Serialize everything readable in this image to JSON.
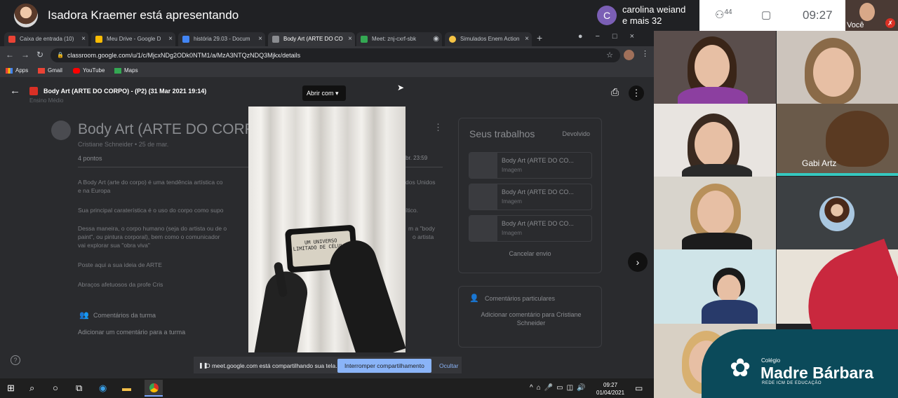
{
  "meet": {
    "presenter_title": "Isadora Kraemer está apresentando",
    "participants": {
      "initial": "C",
      "line1": "carolina weiand",
      "line2": "e mais 32"
    },
    "people_count": "44",
    "clock": "09:27",
    "self_label": "Você"
  },
  "browser": {
    "tabs": [
      {
        "label": "Caixa de entrada (10)",
        "color": "#ea4335"
      },
      {
        "label": "Meu Drive - Google D",
        "color": "#fbbc04"
      },
      {
        "label": "história 29.03 - Docum",
        "color": "#4285f4"
      },
      {
        "label": "Body Art (ARTE DO CO",
        "color": "#8a8c90"
      },
      {
        "label": "Meet: znj-cxrf-sbk",
        "color": "#34a853"
      },
      {
        "label": "Simulados Enem Action",
        "color": "#f6c445"
      }
    ],
    "url": "classroom.google.com/u/1/c/MjcxNDg2ODk0NTM1/a/MzA3NTQzNDQ3Mjkx/details",
    "bookmarks": [
      {
        "label": "Apps",
        "color": "#ea4335"
      },
      {
        "label": "Gmail",
        "color": "#ea4335"
      },
      {
        "label": "YouTube",
        "color": "#ff0000"
      },
      {
        "label": "Maps",
        "color": "#34a853"
      }
    ]
  },
  "viewer": {
    "file_title": "Body Art (ARTE DO CORPO) - (P2) (31 Mar 2021 19:14)",
    "open_with": "Abrir com",
    "subtitle": "Ensino Médio"
  },
  "assignment": {
    "title": "Body Art (ARTE DO CORPO)",
    "author": "Cristiane Schneider • 25 de mar.",
    "points": "4 pontos",
    "due": "Data de entrega: 5 de abr. 23:59",
    "paragraphs": [
      "A Body Art (arte do corpo) é uma tendência artística co",
      "Sua principal caraterística é o uso do corpo como supo",
      "Dessa maneira, o corpo humano (seja do artista ou de o",
      "Poste aqui a sua ideia de ARTE",
      "Abraços afetuosos da profe Cris"
    ],
    "paragraphs_right": [
      "dos Unidos",
      "e na Europa",
      "ítico.",
      "m a \"body",
      "paint\", ou pintura corporal), bem como o comunicador",
      "o artista",
      "vai explorar sua \"obra viva\""
    ],
    "class_comments": "Comentários da turma",
    "add_class_comment": "Adicionar um comentário para a turma"
  },
  "work": {
    "title": "Seus trabalhos",
    "status": "Devolvido",
    "attachments": [
      {
        "name": "Body Art (ARTE DO CO...",
        "type": "Imagem"
      },
      {
        "name": "Body Art (ARTE DO CO...",
        "type": "Imagem"
      },
      {
        "name": "Body Art (ARTE DO CO...",
        "type": "Imagem"
      }
    ],
    "cancel": "Cancelar envio",
    "private_label": "Comentários particulares",
    "private_add": "Adicionar comentário para Cristiane Schneider"
  },
  "photo_text": "UM UNIVERSO LIMITADO DE CÉLULAS",
  "share_banner": {
    "text": "O meet.google.com está compartilhando sua tela.",
    "stop": "Interromper compartilhamento",
    "hide": "Ocultar"
  },
  "taskbar": {
    "time": "09:27",
    "date": "01/04/2021"
  },
  "tiles": {
    "gabi": "Gabi Artz"
  },
  "logo": {
    "small": "Colégio",
    "main": "Madre Bárbara",
    "sub": "REDE ICM DE EDUCAÇÃO"
  }
}
